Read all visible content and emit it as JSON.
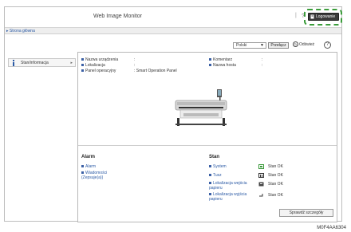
{
  "header": {
    "app_title": "Web Image Monitor",
    "separator": "|",
    "help_icon": "?",
    "login_label": "Logowanie"
  },
  "breadcrumb": {
    "label": "▸ Strona główna"
  },
  "sidebar": {
    "items": [
      {
        "label": "Stan/informacja",
        "icon": "info-icon",
        "arrow": "▸"
      }
    ]
  },
  "toolbar": {
    "language_value": "Polski",
    "switch_label": "Przełącz",
    "refresh_label": "Odśwież",
    "help_label": "?"
  },
  "device_info": {
    "name_label": "Nazwa urządzenia",
    "name_value": ":",
    "location_label": "Lokalizacja",
    "location_value": ":",
    "panel_label": "Panel operacyjny",
    "panel_value": ": Smart Operation Panel",
    "comment_label": "Komentarz",
    "comment_value": ":",
    "host_label": "Nazwa hosta",
    "host_value": ":"
  },
  "alarm": {
    "title": "Alarm",
    "links": [
      "Alarm",
      "Wiadomości (Zepsuje(a))"
    ]
  },
  "status": {
    "title": "Stan",
    "rows": [
      {
        "label": "System",
        "value": "Stan OK",
        "icon": "system-ok-icon"
      },
      {
        "label": "Tusz",
        "value": "Stan OK",
        "icon": "ink-icon"
      },
      {
        "label": "Lokalizacja wejścia papieru",
        "value": "Stan OK",
        "icon": "paper-input-icon"
      },
      {
        "label": "Lokalizacja wyjścia papieru",
        "value": "Stan OK",
        "icon": "paper-output-icon"
      }
    ]
  },
  "details_button": "Sprawdź szczegóły",
  "figure_code": "M0F4AA6304",
  "colors": {
    "link_blue": "#2b5aa5",
    "login_bg": "#3a3a3a",
    "highlight_green": "#3a9c3a",
    "status_ok_green": "#3c9a3c"
  }
}
